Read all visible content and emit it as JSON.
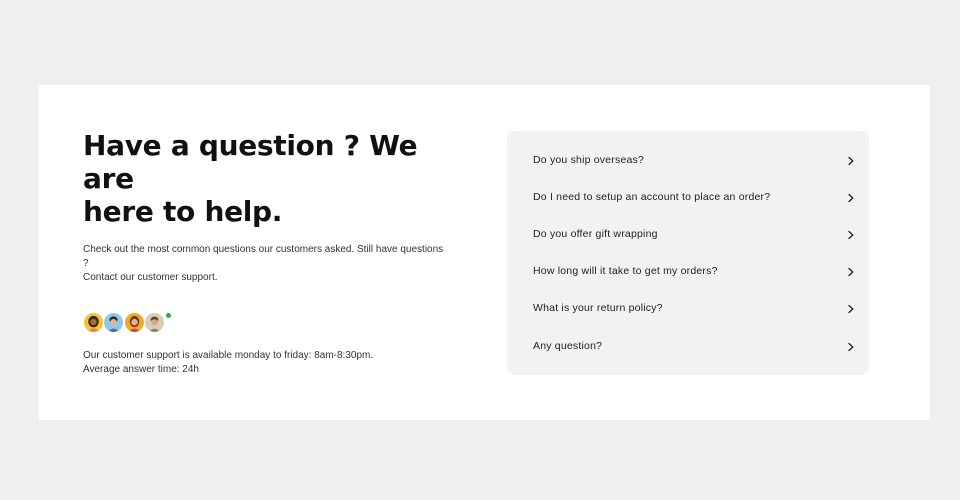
{
  "hero": {
    "title_line1": "Have a question ? We are",
    "title_line2": "here to help.",
    "intro_line1": "Check out the most common questions our customers asked. Still have questions ?",
    "intro_line2": "Contact our customer support."
  },
  "support": {
    "hours": "Our customer support is available monday to friday: 8am-8:30pm.",
    "response_time": "Average answer time: 24h",
    "avatar_icons": [
      "avatar-person-1",
      "avatar-person-2",
      "avatar-person-3",
      "avatar-person-4"
    ],
    "online_color": "#22b04b"
  },
  "faq": {
    "items": [
      {
        "question": "Do you ship overseas?",
        "icon": "chevron-right-icon"
      },
      {
        "question": "Do I need to setup an account to place an order?",
        "icon": "chevron-right-icon"
      },
      {
        "question": "Do you offer gift wrapping",
        "icon": "chevron-right-icon"
      },
      {
        "question": "How long will it take to get my orders?",
        "icon": "chevron-right-icon"
      },
      {
        "question": "What is your return policy?",
        "icon": "chevron-right-icon"
      },
      {
        "question": "Any question?",
        "icon": "chevron-right-icon"
      }
    ]
  },
  "colors": {
    "page_background": "#efefef",
    "card_background": "#ffffff",
    "faq_background": "#f2f2f2",
    "text": "#111111"
  }
}
